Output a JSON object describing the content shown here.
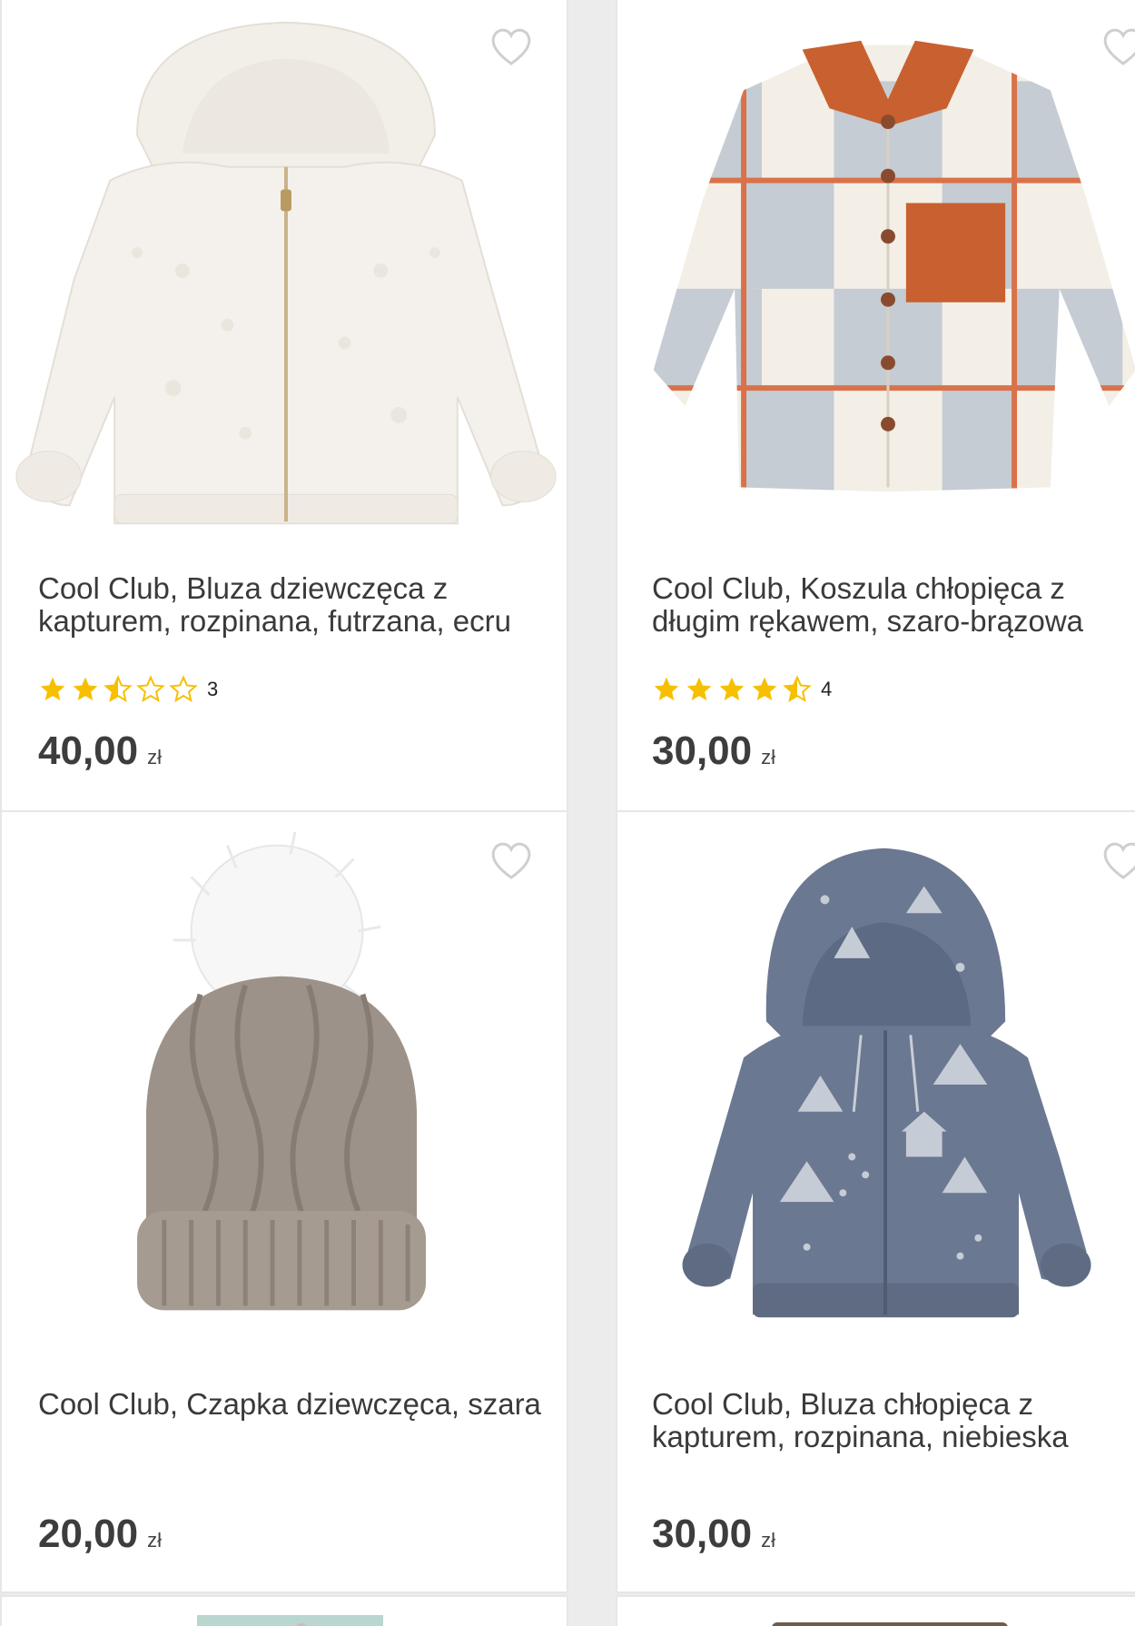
{
  "products": [
    {
      "title": "Cool Club, Bluza dziewczęca z kapturem, rozpinana, futrzana, ecru",
      "rating_value": 2.5,
      "rating_count": "3",
      "price": "40,00",
      "currency": "zł",
      "image": "white-fleece-hooded-jacket"
    },
    {
      "title": "Cool Club, Koszula chłopięca z długim rękawem, szaro-brązowa",
      "rating_value": 4.5,
      "rating_count": "4",
      "price": "30,00",
      "currency": "zł",
      "image": "plaid-shirt-orange-collar"
    },
    {
      "title": "Cool Club, Czapka dziewczęca, szara",
      "price": "20,00",
      "currency": "zł",
      "image": "knit-beanie-pompom"
    },
    {
      "title": "Cool Club, Bluza chłopięca z kapturem, rozpinana, niebieska",
      "price": "30,00",
      "currency": "zł",
      "image": "blue-printed-zip-hoodie"
    }
  ],
  "colors": {
    "star": "#f6c000",
    "heart_outline": "#cfcfcf",
    "text": "#3a3a3a"
  },
  "icons": {
    "wishlist": "heart-outline-icon",
    "rating_full": "star-filled-icon",
    "rating_half": "star-half-icon",
    "rating_empty": "star-outline-icon"
  }
}
